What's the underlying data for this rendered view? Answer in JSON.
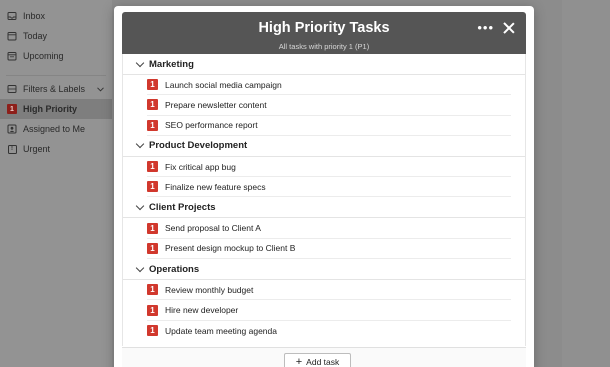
{
  "sidebar": {
    "items": [
      {
        "label": "Inbox",
        "icon": "inbox-icon"
      },
      {
        "label": "Today",
        "icon": "calendar-today-icon"
      },
      {
        "label": "Upcoming",
        "icon": "calendar-upcoming-icon"
      }
    ],
    "filters_label": "Filters & Labels",
    "filter_items": [
      {
        "label": "High Priority",
        "badge": "1",
        "active": true
      },
      {
        "label": "Assigned to Me",
        "icon": "person-icon"
      },
      {
        "label": "Urgent",
        "icon": "exclamation-icon",
        "glyph": "!"
      }
    ]
  },
  "modal": {
    "title": "High Priority Tasks",
    "subtitle": "All tasks with priority 1 (P1)",
    "more_glyph": "•••",
    "add_task_plus": "+",
    "add_task_label": "Add task",
    "priority_badge": "1",
    "colors": {
      "priority": "#d1382d",
      "header": "#555555"
    },
    "groups": [
      {
        "name": "Marketing",
        "tasks": [
          "Launch social media campaign",
          "Prepare newsletter content",
          "SEO performance report"
        ]
      },
      {
        "name": "Product Development",
        "tasks": [
          "Fix critical app bug",
          "Finalize new feature specs"
        ]
      },
      {
        "name": "Client Projects",
        "tasks": [
          "Send proposal to Client A",
          "Present design mockup to Client B"
        ]
      },
      {
        "name": "Operations",
        "tasks": [
          "Review monthly budget",
          "Hire new developer",
          "Update team meeting agenda"
        ]
      }
    ]
  }
}
